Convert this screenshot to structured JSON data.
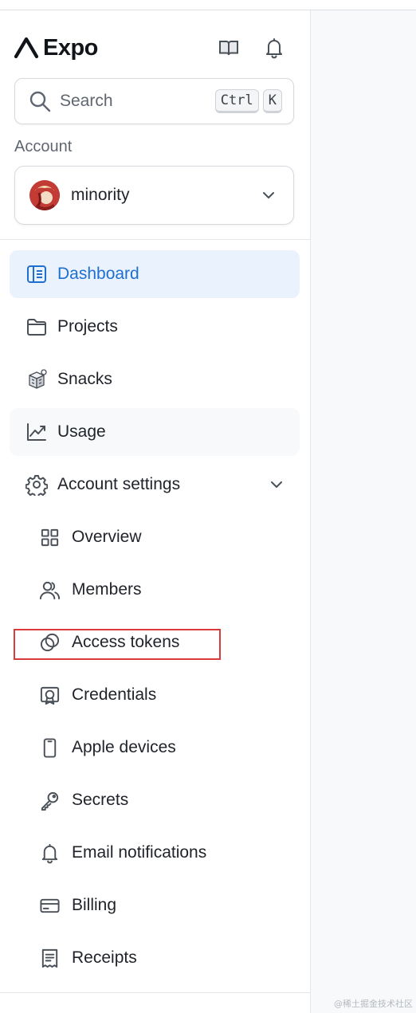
{
  "app": {
    "name": "Expo"
  },
  "header": {
    "docs_icon": "book-icon",
    "notifications_icon": "bell-icon"
  },
  "search": {
    "placeholder": "Search",
    "shortcut_keys": [
      "Ctrl",
      "K"
    ]
  },
  "account": {
    "label": "Account",
    "selected": "minority"
  },
  "nav": {
    "items": [
      {
        "label": "Dashboard",
        "icon": "dashboard-icon",
        "state": "active"
      },
      {
        "label": "Projects",
        "icon": "folder-icon"
      },
      {
        "label": "Snacks",
        "icon": "snack-icon"
      },
      {
        "label": "Usage",
        "icon": "chart-line-icon",
        "state": "hover"
      },
      {
        "label": "Account settings",
        "icon": "gear-icon",
        "expanded": true
      }
    ],
    "settings_items": [
      {
        "label": "Overview",
        "icon": "grid-icon"
      },
      {
        "label": "Members",
        "icon": "users-icon"
      },
      {
        "label": "Access tokens",
        "icon": "tokens-icon",
        "highlighted": true
      },
      {
        "label": "Credentials",
        "icon": "certificate-icon"
      },
      {
        "label": "Apple devices",
        "icon": "phone-icon"
      },
      {
        "label": "Secrets",
        "icon": "key-icon"
      },
      {
        "label": "Email notifications",
        "icon": "bell-icon"
      },
      {
        "label": "Billing",
        "icon": "credit-card-icon"
      },
      {
        "label": "Receipts",
        "icon": "receipt-icon"
      }
    ]
  },
  "colors": {
    "accent": "#1f6fd1",
    "active_bg": "#e9f2fd",
    "highlight_box": "#d93a3a"
  },
  "watermark": "@稀土掘金技术社区"
}
